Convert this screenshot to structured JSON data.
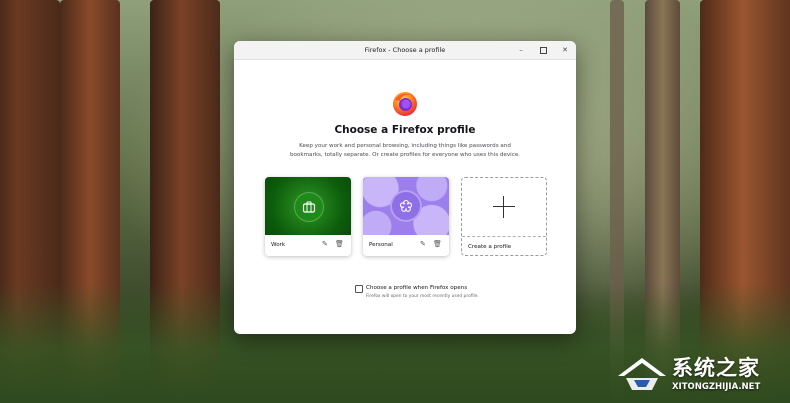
{
  "window": {
    "title": "Firefox - Choose a profile",
    "controls": {
      "minimize": "–",
      "close": "✕"
    }
  },
  "dialog": {
    "heading": "Choose a Firefox profile",
    "description": "Keep your work and personal browsing, including things like passwords and bookmarks, totally separate. Or create profiles for everyone who uses this device.",
    "profiles": [
      {
        "name": "Work",
        "icon": "briefcase-icon",
        "color": "#1e7a17"
      },
      {
        "name": "Personal",
        "icon": "flower-icon",
        "color": "#9c7fea"
      }
    ],
    "create_label": "Create a profile",
    "checkbox": {
      "label": "Choose a profile when Firefox opens",
      "sublabel": "Firefox will open to your most recently used profile.",
      "checked": false
    }
  },
  "watermark": {
    "name": "系统之家",
    "url": "XITONGZHIJIA.NET"
  },
  "colors": {
    "accent": "#ff7139",
    "text": "#15141a"
  }
}
